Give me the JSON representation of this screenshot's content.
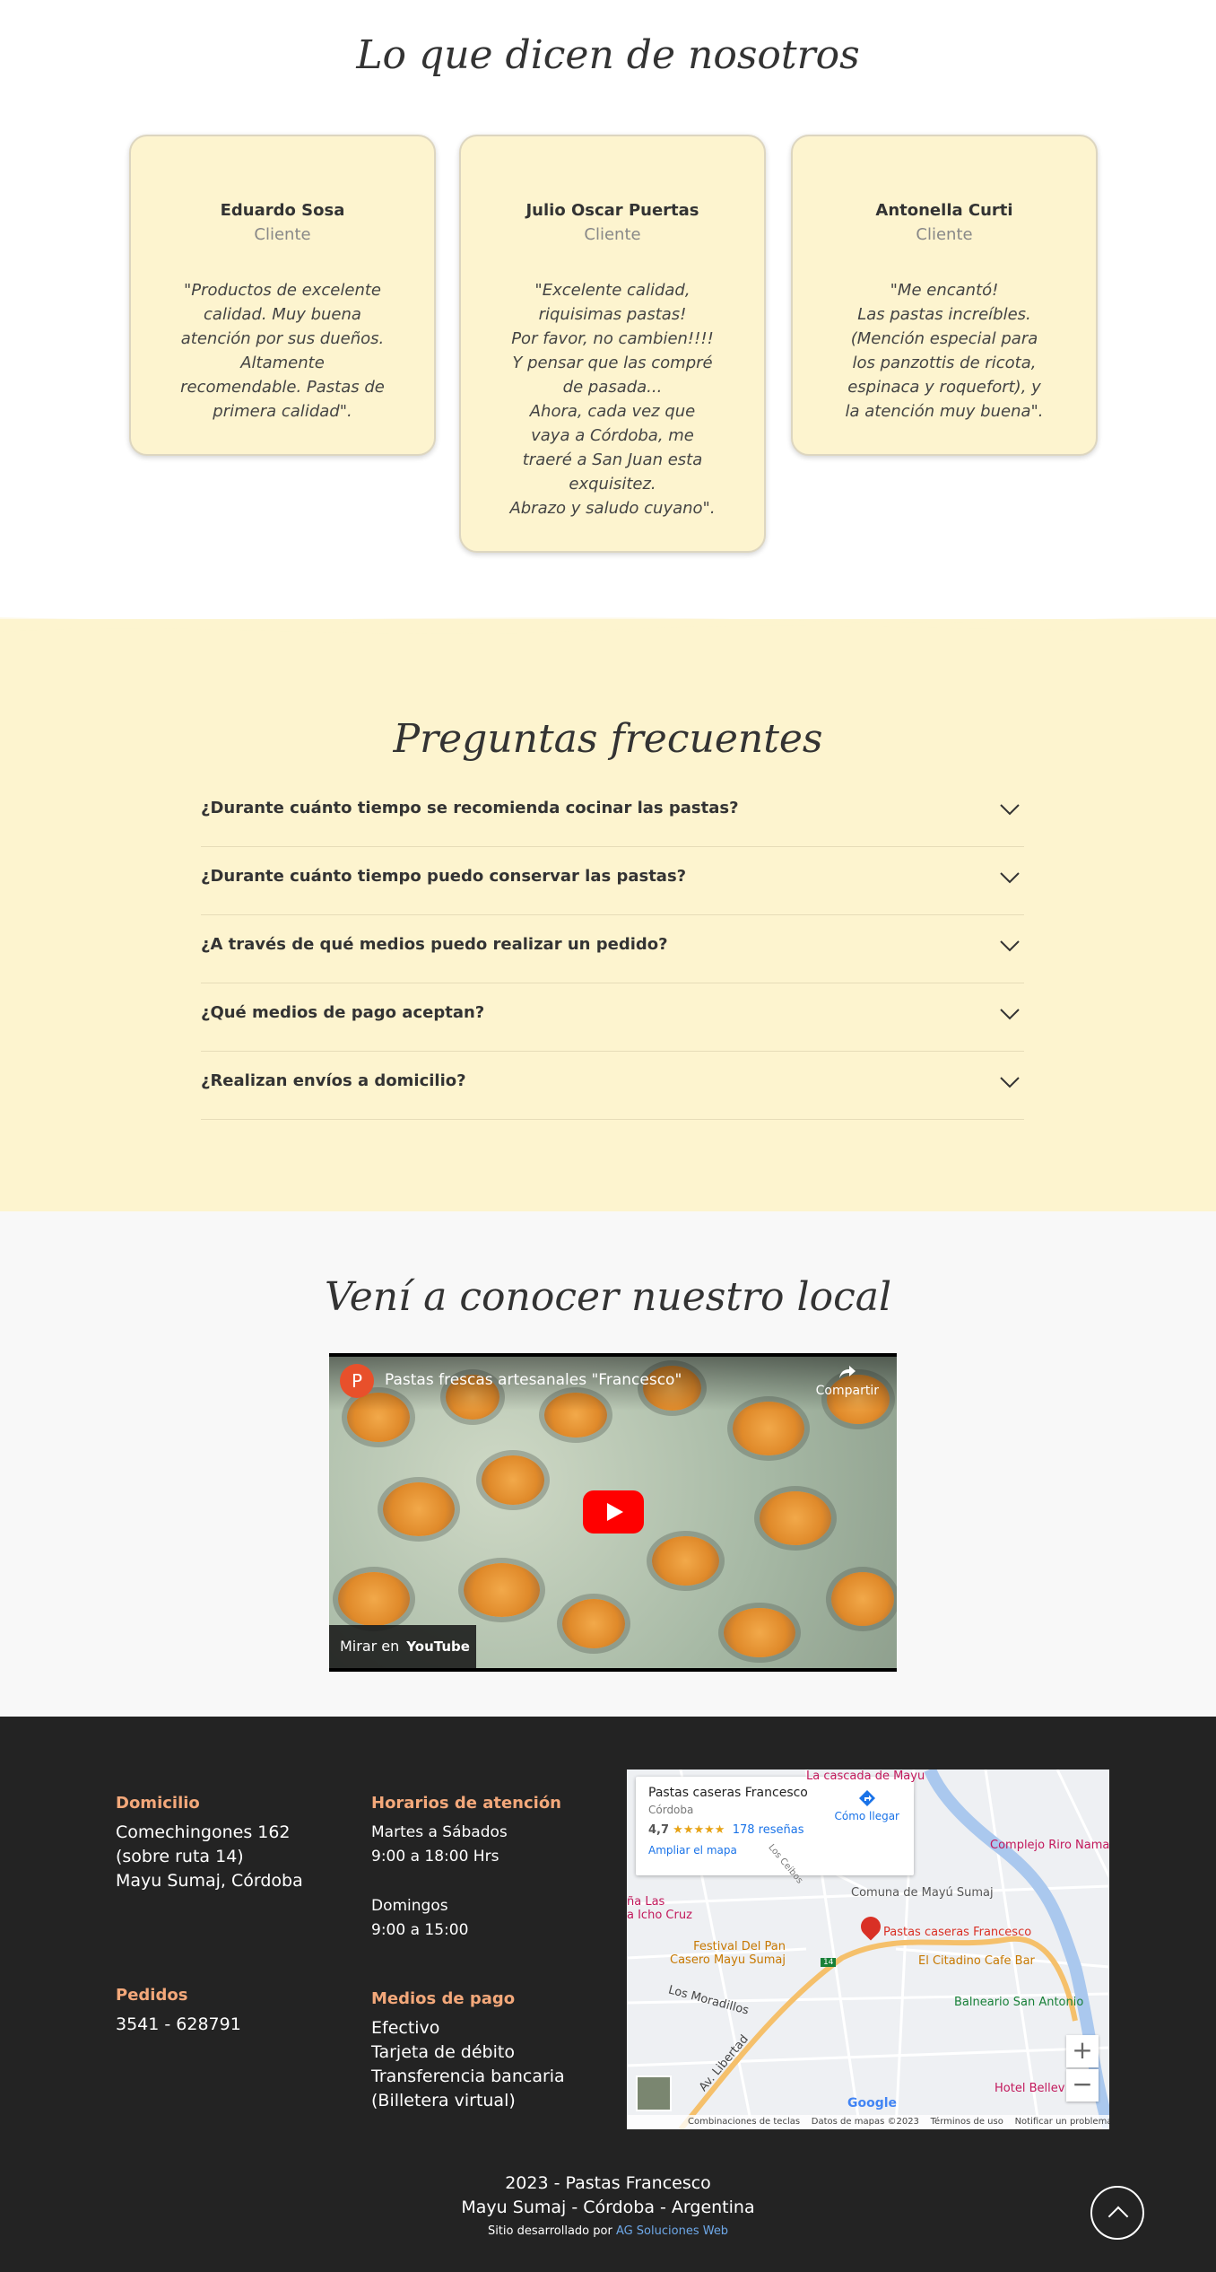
{
  "testimonials": {
    "title": "Lo que dicen de nosotros",
    "items": [
      {
        "name": "Eduardo Sosa",
        "role": "Cliente",
        "quote": "\"Productos de excelente\ncalidad. Muy buena\natención por sus dueños.\nAltamente\nrecomendable. Pastas de\nprimera calidad\"."
      },
      {
        "name": "Julio Oscar Puertas",
        "role": "Cliente",
        "quote": "\"Excelente calidad,\nriquisimas pastas!\nPor favor, no cambien!!!!\nY pensar que las compré\nde pasada...\nAhora, cada vez que\nvaya a Córdoba, me\ntraeré a San Juan esta\nexquisitez.\nAbrazo y saludo cuyano\"."
      },
      {
        "name": "Antonella Curti",
        "role": "Cliente",
        "quote": "\"Me encantó!\nLas pastas increíbles.\n(Mención especial para\nlos panzottis de ricota,\nespinaca y roquefort), y\nla atención muy buena\"."
      }
    ]
  },
  "faq": {
    "title": "Preguntas frecuentes",
    "items": [
      "¿Durante cuánto tiempo se recomienda cocinar las pastas?",
      "¿Durante cuánto tiempo puedo conservar las pastas?",
      "¿A través de qué medios puedo realizar un pedido?",
      "¿Qué medios de pago aceptan?",
      "¿Realizan envíos a domicilio?"
    ]
  },
  "local": {
    "title": "Vení a conocer nuestro local",
    "video": {
      "channel_initial": "P",
      "title": "Pastas frescas artesanales \"Francesco\"",
      "share_label": "Compartir",
      "watch_label": "Mirar en",
      "youtube_label": "YouTube"
    }
  },
  "footer": {
    "domicilio": {
      "heading": "Domicilio",
      "text": "Comechingones 162\n(sobre ruta 14)\nMayu Sumaj, Córdoba"
    },
    "pedidos": {
      "heading": "Pedidos",
      "text": "3541 - 628791"
    },
    "horarios": {
      "heading": "Horarios de atención",
      "text1": "Martes a Sábados\n9:00 a 18:00 Hrs",
      "text2": "Domingos\n9:00 a 15:00"
    },
    "pagos": {
      "heading": "Medios de pago",
      "text": "Efectivo\nTarjeta de débito\nTransferencia bancaria\n(Billetera virtual)"
    },
    "map": {
      "place": "Pastas caseras Francesco",
      "city": "Córdoba",
      "rating": "4,7",
      "stars": "★★★★★",
      "reviews": "178 reseñas",
      "enlarge": "Ampliar el mapa",
      "directions": "Cómo llegar",
      "labels": {
        "cascada": "La cascada de Mayu",
        "complejo": "Complejo Riro Namas",
        "comuna": "Comuna de Mayú Sumaj",
        "icho": "ña Las\na Icho Cruz",
        "festival": "Festival Del Pan\nCasero Mayu Sumaj",
        "pin": "Pastas caseras Francesco",
        "citadino": "El Citadino Cafe Bar",
        "balneario": "Balneario San Antonio",
        "moradillos": "Los Moradillos",
        "libertad": "Av. Libertad",
        "hotel": "Hotel Bellev",
        "ruta": "14",
        "ceibos": "Los Ceibos"
      },
      "footer_items": [
        "Combinaciones de teclas",
        "Datos de mapas ©2023",
        "Términos de uso",
        "Notificar un problema de Maps"
      ],
      "google": "Google"
    },
    "copyright": "2023 - Pastas Francesco",
    "location": "Mayu Sumaj - Córdoba - Argentina",
    "credit_prefix": "Sitio desarrollado por",
    "credit_link": "AG Soluciones Web"
  }
}
